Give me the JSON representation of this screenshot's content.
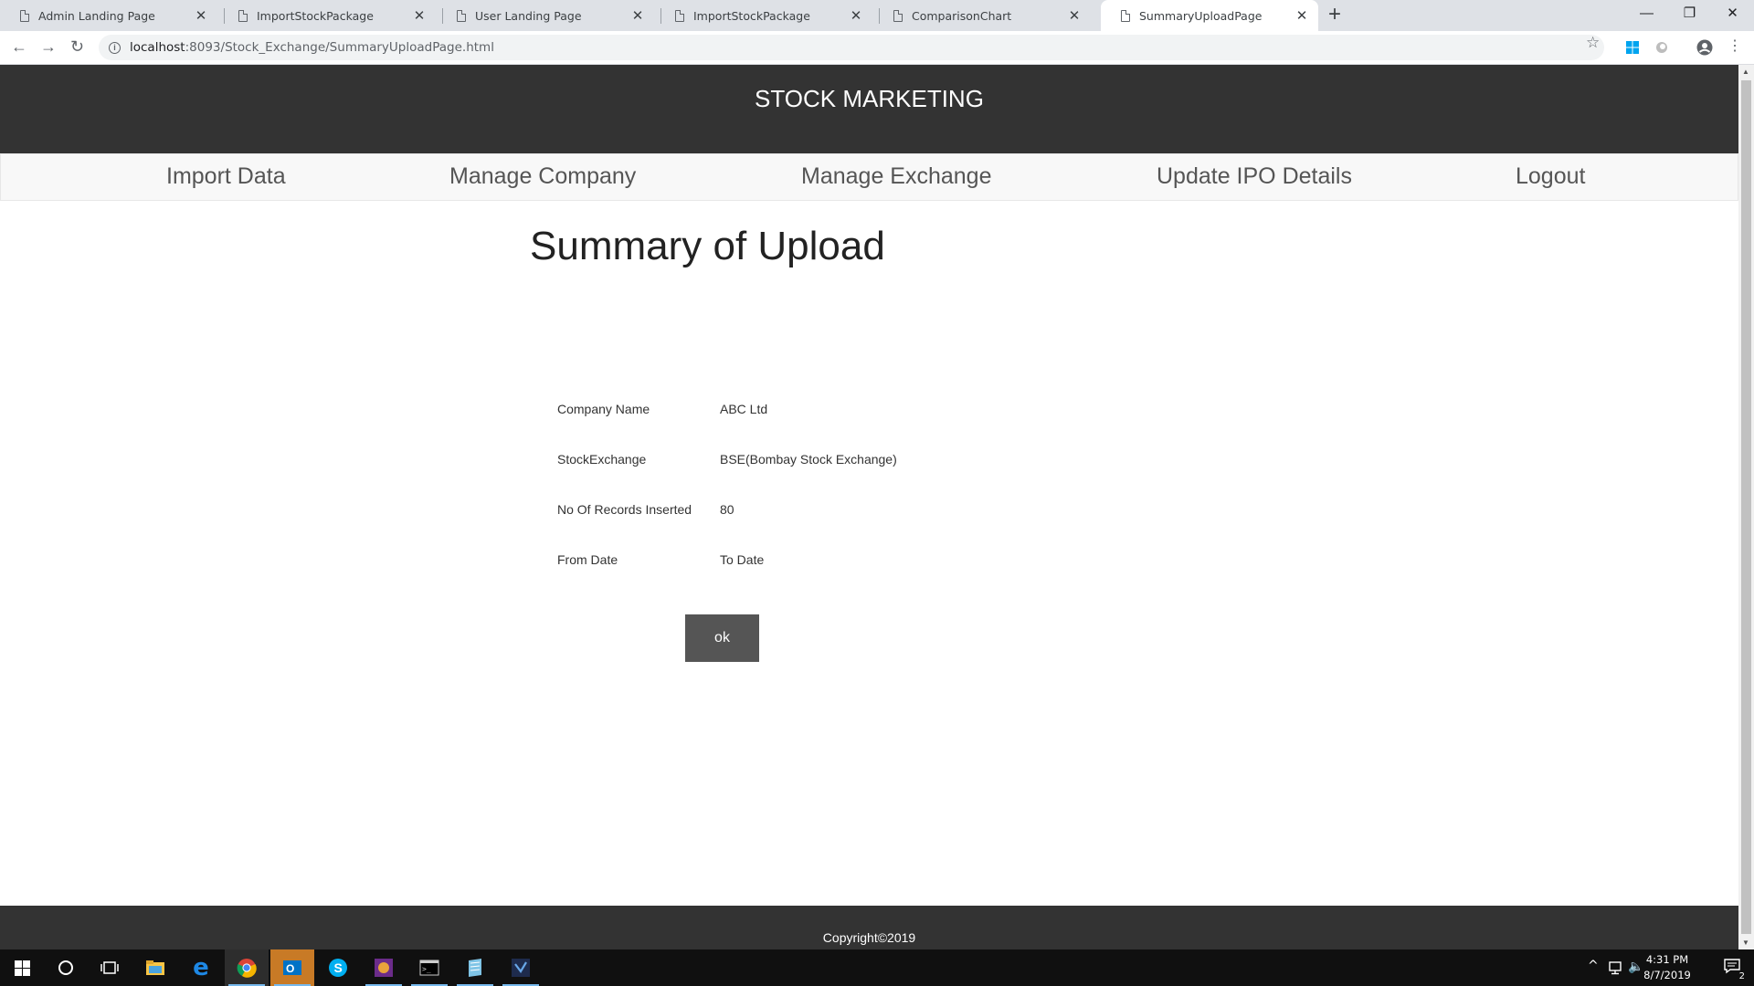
{
  "browser": {
    "tabs": [
      {
        "title": "Admin Landing Page",
        "active": false
      },
      {
        "title": "ImportStockPackage",
        "active": false
      },
      {
        "title": "User Landing Page",
        "active": false
      },
      {
        "title": "ImportStockPackage",
        "active": false
      },
      {
        "title": "ComparisonChart",
        "active": false
      },
      {
        "title": "SummaryUploadPage",
        "active": true
      }
    ],
    "url_host": "localhost",
    "url_rest": ":8093/Stock_Exchange/SummaryUploadPage.html"
  },
  "header": {
    "title": "STOCK MARKETING"
  },
  "nav": {
    "items": [
      "Import Data",
      "Manage Company",
      "Manage Exchange",
      "Update IPO Details",
      "Logout"
    ]
  },
  "main": {
    "heading": "Summary of Upload",
    "rows": [
      {
        "label": "Company Name",
        "value": "ABC Ltd"
      },
      {
        "label": "StockExchange",
        "value": "BSE(Bombay Stock Exchange)"
      },
      {
        "label": "No Of Records Inserted",
        "value": "80"
      },
      {
        "label": "From Date",
        "value": "To Date"
      }
    ],
    "ok_label": "ok"
  },
  "footer": {
    "text": "Copyright©2019"
  },
  "taskbar": {
    "time": "4:31 PM",
    "date": "8/7/2019",
    "notification_count": "2"
  },
  "colors": {
    "header_bg": "#333333",
    "button_bg": "#555555",
    "navbar_bg": "#f8f8f8"
  }
}
